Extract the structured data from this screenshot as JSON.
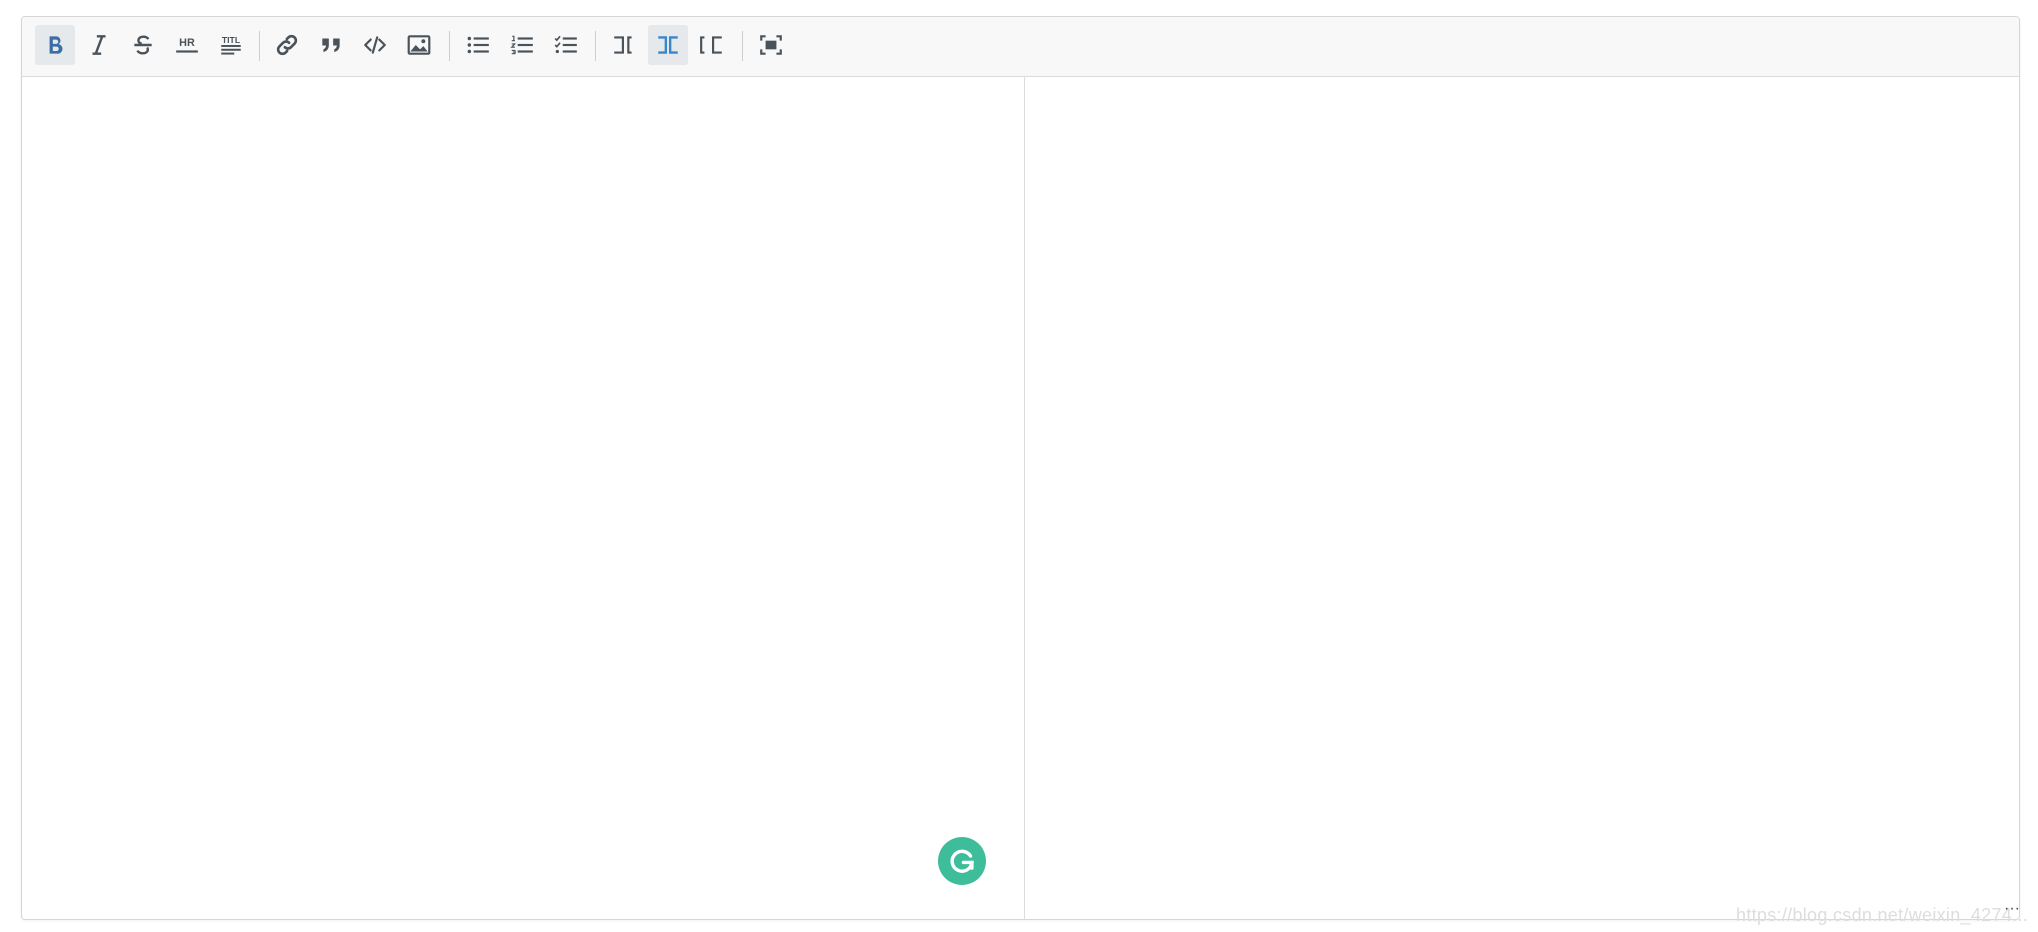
{
  "toolbar": {
    "buttons": [
      {
        "name": "bold-button",
        "icon": "bold-icon",
        "active": true
      },
      {
        "name": "italic-button",
        "icon": "italic-icon"
      },
      {
        "name": "strikethrough-button",
        "icon": "strikethrough-icon"
      },
      {
        "name": "horizontal-rule-button",
        "icon": "horizontal-rule-icon",
        "label": "HR"
      },
      {
        "name": "heading-button",
        "icon": "heading-icon",
        "label": "TITL"
      },
      {
        "name": "link-button",
        "icon": "link-icon"
      },
      {
        "name": "quote-button",
        "icon": "quote-icon"
      },
      {
        "name": "code-button",
        "icon": "code-icon"
      },
      {
        "name": "image-button",
        "icon": "image-icon"
      },
      {
        "name": "unordered-list-button",
        "icon": "unordered-list-icon"
      },
      {
        "name": "ordered-list-button",
        "icon": "ordered-list-icon"
      },
      {
        "name": "task-list-button",
        "icon": "task-list-icon"
      },
      {
        "name": "editor-only-button",
        "icon": "editor-only-icon"
      },
      {
        "name": "split-view-button",
        "icon": "split-view-icon",
        "active": true
      },
      {
        "name": "preview-only-button",
        "icon": "preview-only-icon"
      },
      {
        "name": "fullscreen-button",
        "icon": "fullscreen-icon"
      }
    ]
  },
  "colors": {
    "accent": "#3b86c8",
    "icon": "#4a525a",
    "grammarly": "#3ebd9a"
  },
  "watermark": "https://blog.csdn.net/weixin_4274..."
}
